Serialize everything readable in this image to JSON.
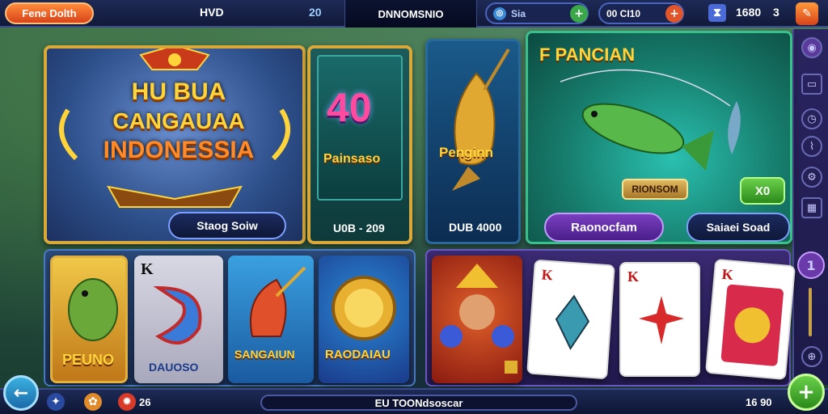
{
  "topbar": {
    "brand_button": "Fene Dolth",
    "currency_label": "HVD",
    "currency_value": "20",
    "center_tab": "DNNOMSNIO",
    "search_text": "Sia",
    "coins": "00 CI10",
    "gems": "1680",
    "multiplier": "3"
  },
  "hero": {
    "line1": "HU BUA",
    "line2": "CANGAUAA",
    "line3": "INDONESSIA",
    "button": "Staog Soiw"
  },
  "card_40": {
    "number": "40",
    "title": "Painsaso",
    "footer": "U0B - 209"
  },
  "card_fish_left": {
    "title": "Penginn",
    "footer": "DUB 4000"
  },
  "card_fishing": {
    "title": "F PANCIAN",
    "badge": "RIONSOM",
    "score": "X0",
    "button_left": "Raonocfam",
    "button_right": "Saiaei Soad"
  },
  "row2": [
    {
      "title": "PEUNO"
    },
    {
      "title": "DAUOSO",
      "corner": "K"
    },
    {
      "title": "SANGAIUN"
    },
    {
      "title": "RAODAIAU"
    }
  ],
  "cards_panel": {
    "playing_cards": [
      "K",
      "K",
      "K"
    ]
  },
  "bottombar": {
    "count": "26",
    "status_text": "EU TOONdsoscar",
    "right_value": "16 90"
  },
  "colors": {
    "gold": "#d9a83a",
    "purple": "#6a3aaa",
    "navy": "#1d2a55"
  }
}
